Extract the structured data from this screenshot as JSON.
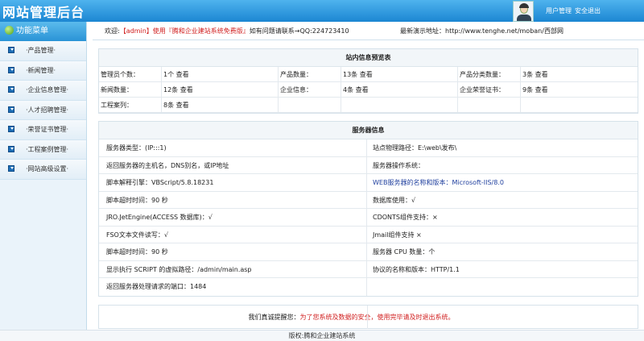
{
  "header": {
    "title": "网站管理后台",
    "user_manage": "用户管理",
    "safe_exit": "安全退出"
  },
  "sidebar": {
    "heading": "功能菜单",
    "items": [
      "产品管理",
      "新闻管理",
      "企业信息管理",
      "人才招聘管理",
      "荣誉证书管理",
      "工程案例管理",
      "网站高级设置"
    ]
  },
  "welcome": {
    "prefix": "欢迎:",
    "user": "【admin】使用『腾和企业建站系统免费版』",
    "contact": "如有问题请联系→QQ:224723410",
    "demo_site": "最新演示地址：http://www.tenghe.net/moban/西部网"
  },
  "stats": {
    "title": "站内信息预览表",
    "rows": [
      [
        {
          "label": "管理员个数：",
          "value": "1个 查看"
        },
        {
          "label": "产品数量：",
          "value": "13条 查看"
        },
        {
          "label": "产品分类数量：",
          "value": "3条 查看"
        }
      ],
      [
        {
          "label": "新闻数量：",
          "value": "12条 查看"
        },
        {
          "label": "企业信息：",
          "value": "4条 查看"
        },
        {
          "label": "企业荣誉证书：",
          "value": "9条 查看"
        }
      ],
      [
        {
          "label": "工程案列：",
          "value": "8条 查看"
        },
        {
          "label": "",
          "value": ""
        },
        {
          "label": "",
          "value": ""
        }
      ]
    ]
  },
  "server": {
    "title": "服务器信息",
    "rows": [
      [
        "服务器类型：(IP:::1)",
        "站点物理路径：E:\\web\\发布\\"
      ],
      [
        "返回服务器的主机名，DNS别名，或IP地址",
        "服务器操作系统："
      ],
      [
        "脚本解释引擎：VBScript/5.8.18231",
        "WEB服务器的名称和版本：Microsoft-IIS/8.0"
      ],
      [
        "脚本超时时间：90 秒",
        "数据库使用：√"
      ],
      [
        "JRO.JetEngine(ACCESS 数据库)：√",
        "CDONTS组件支持：×"
      ],
      [
        "FSO文本文件读写：√",
        "Jmail组件支持 ×"
      ],
      [
        "脚本超时时间：90 秒",
        "服务器 CPU 数量：个"
      ],
      [
        "显示执行 SCRIPT 的虚拟路径：/admin/main.asp",
        "协议的名称和版本：HTTP/1.1"
      ],
      [
        "返回服务器处理请求的端口：1484",
        ""
      ]
    ]
  },
  "notice": {
    "prefix": "我们真诚提醒您：",
    "text": "为了您系统及数据的安全，使用完毕请及时退出系统。"
  },
  "footer": {
    "copyright": "版权:腾和企业建站系统"
  }
}
